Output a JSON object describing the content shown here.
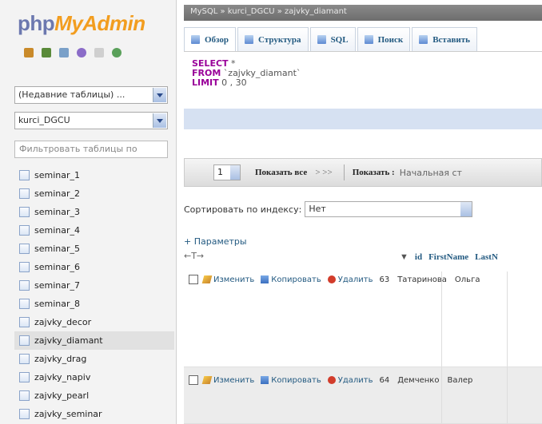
{
  "sidebar": {
    "logo_php": "php",
    "logo_myadmin": "MyAdmin",
    "recent_select": "(Недавние таблицы) ...",
    "db_select": "kurci_DGCU",
    "filter_placeholder": "Фильтровать таблицы по",
    "tables": [
      "seminar_1",
      "seminar_2",
      "seminar_3",
      "seminar_4",
      "seminar_5",
      "seminar_6",
      "seminar_7",
      "seminar_8",
      "zajvky_decor",
      "zajvky_diamant",
      "zajvky_drag",
      "zajvky_napiv",
      "zajvky_pearl",
      "zajvky_seminar"
    ],
    "selected_table": "zajvky_diamant"
  },
  "breadcrumb": {
    "text": "MySQL » kurci_DGCU » zajvky_diamant"
  },
  "tabs": [
    "Обзор",
    "Структура",
    "SQL",
    "Поиск",
    "Вставить"
  ],
  "sql": {
    "select_kw": "SELECT",
    "select_rest": " *",
    "from_kw": "FROM",
    "from_rest": " `zajvky_diamant`",
    "limit_kw": "LIMIT",
    "limit_rest": " 0 , 30"
  },
  "navbar": {
    "page": "1",
    "show_all": "Показать все",
    "arrows": "> >>",
    "show_label": "Показать :",
    "start_text": "Начальная ст"
  },
  "sort": {
    "label": "Сортировать по индексу:",
    "value": "Нет"
  },
  "params_link": "+ Параметры",
  "move_arrows": "←T→",
  "columns": {
    "sort_marker": "▼",
    "id": "id",
    "first": "FirstName",
    "last": "LastN"
  },
  "row_actions": {
    "edit": "Изменить",
    "copy": "Копировать",
    "delete": "Удалить"
  },
  "rows": [
    {
      "id": "63",
      "first": "Татаринова",
      "last": "Ольга"
    },
    {
      "id": "64",
      "first": "Демченко",
      "last": "Валер"
    }
  ]
}
